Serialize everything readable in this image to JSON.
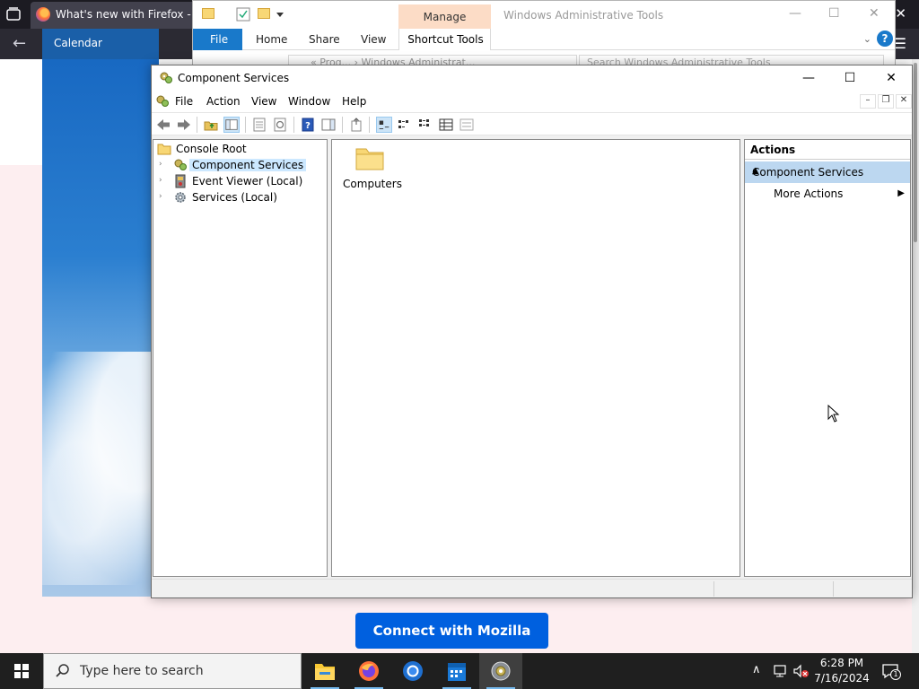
{
  "firefox": {
    "tab_title": "What's new with Firefox - Mozilla",
    "close_glyph": "✕",
    "back_glyph": "←",
    "menu_glyph": "☰",
    "connect_button": "Connect with Mozilla"
  },
  "calendar": {
    "title": "Calendar"
  },
  "explorer": {
    "contextual_tab_group": "Manage",
    "title": "Windows Administrative Tools",
    "ribbon_tabs": [
      "File",
      "Home",
      "Share",
      "View",
      "Shortcut Tools"
    ],
    "address_path": "«  Prog...  ›  Windows Administrat...",
    "search_placeholder": "Search Windows Administrative Tools",
    "help_glyph": "?"
  },
  "mmc": {
    "title": "Component Services",
    "menu": [
      "File",
      "Action",
      "View",
      "Window",
      "Help"
    ],
    "tree": {
      "root": "Console Root",
      "items": [
        "Component Services",
        "Event Viewer (Local)",
        "Services (Local)"
      ],
      "selected": "Component Services"
    },
    "content_items": [
      "Computers"
    ],
    "actions": {
      "header": "Actions",
      "section": "Component Services",
      "items": [
        "More Actions"
      ]
    }
  },
  "taskbar": {
    "search_placeholder": "Type here to search",
    "time": "6:28 PM",
    "date": "7/16/2024",
    "notification_count": "1"
  },
  "colors": {
    "accent": "#0060df",
    "selection": "#cce8ff",
    "action_section": "#bcd7f0",
    "taskbar": "#1f1f1f"
  }
}
